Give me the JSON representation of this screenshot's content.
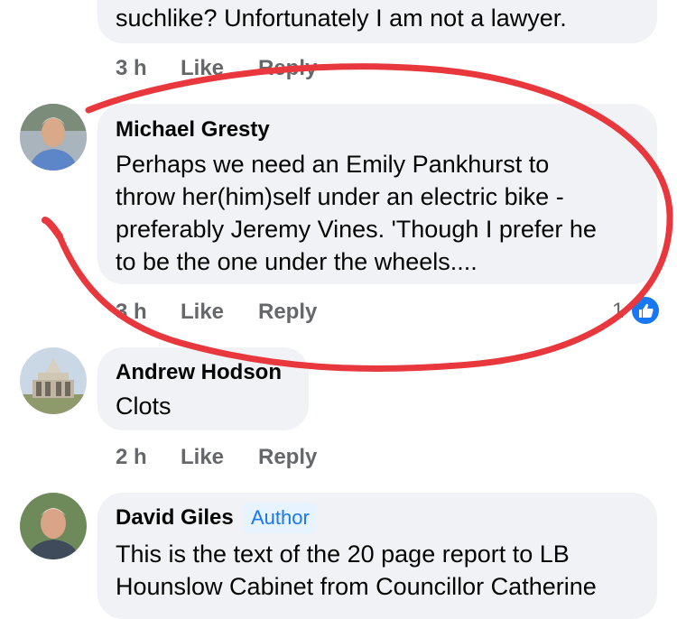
{
  "comments": [
    {
      "lines": [
        "suchlike? Unfortunately I am not a lawyer."
      ],
      "time": "3 h",
      "like": "Like",
      "reply": "Reply"
    },
    {
      "author": "Michael Gresty",
      "lines": [
        "Perhaps we need an Emily Pankhurst to",
        "throw her(him)self under an electric bike -",
        "preferably Jeremy Vines. 'Though I prefer he",
        "to be the one under the wheels...."
      ],
      "time": "3 h",
      "like": "Like",
      "reply": "Reply",
      "reaction_count": "1",
      "reaction_icon": "thumbs-up-icon"
    },
    {
      "author": "Andrew Hodson",
      "lines": [
        "Clots"
      ],
      "time": "2 h",
      "like": "Like",
      "reply": "Reply"
    },
    {
      "author": "David Giles",
      "badge": "Author",
      "lines": [
        "This is the text of the 20 page report to LB",
        "Hounslow Cabinet from Councillor Catherine"
      ]
    }
  ],
  "colors": {
    "bubble": "#f0f2f5",
    "action_text": "#65676b",
    "facebook_blue": "#1877f2",
    "annotation_red": "#e8383d"
  }
}
